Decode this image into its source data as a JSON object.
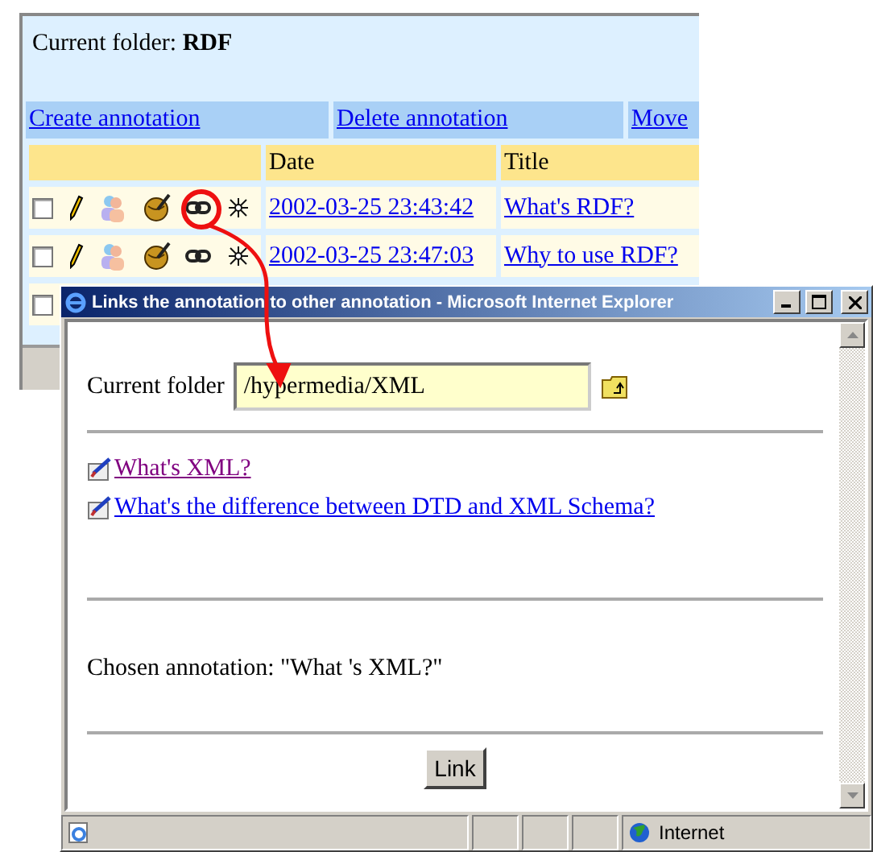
{
  "background_page": {
    "current_folder": "Current folder: **RDF**",
    "actions": [
      "Create annotation",
      "Delete annotation",
      "Move"
    ],
    "columns": [
      "Date",
      "Title"
    ],
    "rows": [
      {
        "checked": false,
        "date": "2002-03-25 23:43:42",
        "title": "What's RDF?"
      },
      {
        "checked": false,
        "date": "2002-03-25 23:47:03",
        "title": "Why to use RDF?"
      },
      {
        "checked": false
      }
    ]
  },
  "dialog": {
    "title": "Links the annotation to other annotation - Microsoft Internet Explorer",
    "folder_label": "Current folder",
    "folder_value": "/hypermedia/XML",
    "annotations": [
      {
        "title": "What's XML?",
        "visited": true
      },
      {
        "title": "What's the difference between DTD and XML Schema?",
        "visited": false
      }
    ],
    "chosen": "Chosen annotation: \"What 's XML?\"",
    "button": "Link",
    "status_zone": "Internet"
  }
}
